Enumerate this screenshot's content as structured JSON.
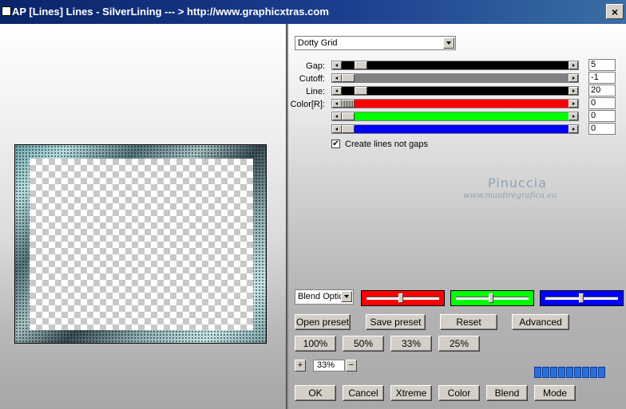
{
  "window": {
    "title": "AP [Lines]  Lines - SilverLining     --- > http://www.graphicxtras.com",
    "close_label": "×"
  },
  "preset_select": {
    "value": "Dotty Grid"
  },
  "params": {
    "gap": {
      "label": "Gap:",
      "value": "5",
      "track_color": "#000000",
      "fraction": 0.06
    },
    "cutoff": {
      "label": "Cutoff:",
      "value": "-1",
      "track_color": "#808080",
      "fraction": 0.0
    },
    "line": {
      "label": "Line:",
      "value": "20",
      "track_color": "#000000",
      "fraction": 0.06
    },
    "color_r": {
      "label": "Color[R]:",
      "value": "0",
      "track_color": "#ff0000",
      "fraction": 0.0
    },
    "color_g": {
      "label": "",
      "value": "0",
      "track_color": "#00ff00",
      "fraction": 0.0
    },
    "color_b": {
      "label": "",
      "value": "0",
      "track_color": "#0000ff",
      "fraction": 0.0
    }
  },
  "create_lines": {
    "label": "Create lines not gaps",
    "checked": true,
    "mark": "✔"
  },
  "watermark": {
    "name": "Pinuccia",
    "url": "www.maidiregrafica.eu"
  },
  "blend_select": {
    "value": "Blend Optio"
  },
  "buttons": {
    "open_preset": "Open preset",
    "save_preset": "Save preset",
    "reset": "Reset",
    "advanced": "Advanced",
    "z100": "100%",
    "z50": "50%",
    "z33": "33%",
    "z25": "25%",
    "ok": "OK",
    "cancel": "Cancel",
    "xtreme": "Xtreme",
    "color": "Color",
    "blend": "Blend",
    "mode": "Mode"
  },
  "zoom": {
    "plus": "+",
    "minus": "−",
    "value": "33%"
  }
}
